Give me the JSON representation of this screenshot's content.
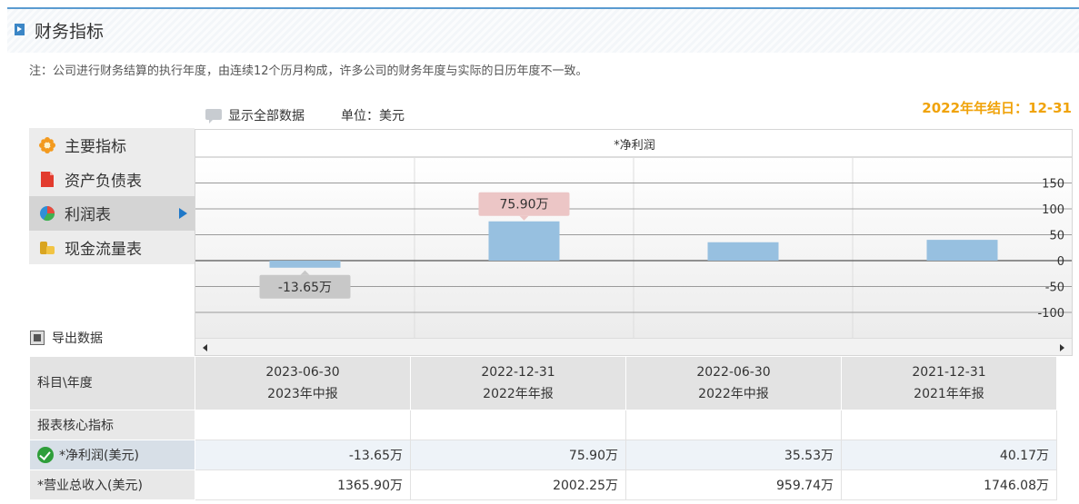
{
  "header": {
    "title": "财务指标"
  },
  "note": "注：公司进行财务结算的执行年度，由连续12个历月构成，许多公司的财务年度与实际的日历年度不一致。",
  "toolbar": {
    "show_all_label": "显示全部数据",
    "unit_label": "单位：美元",
    "year_end": "2022年年结日：12-31"
  },
  "menu": {
    "items": [
      {
        "label": "主要指标",
        "icon": "gear-flower-icon"
      },
      {
        "label": "资产负债表",
        "icon": "document-icon"
      },
      {
        "label": "利润表",
        "icon": "pie-chart-icon"
      },
      {
        "label": "现金流量表",
        "icon": "coins-icon"
      }
    ],
    "active_index": 2
  },
  "export_label": "导出数据",
  "chart_data": {
    "type": "bar",
    "title": "*净利润",
    "categories": [
      "2023-06-30",
      "2022-12-31",
      "2022-06-30",
      "2021-12-31"
    ],
    "values": [
      -13.65,
      75.9,
      35.53,
      40.17
    ],
    "data_labels": [
      "-13.65万",
      "75.90万",
      "",
      ""
    ],
    "yticks": [
      150,
      100,
      50,
      0,
      -50,
      -100
    ],
    "ylim": [
      -150,
      200
    ],
    "grid": true,
    "bar_color": "#97c0e0"
  },
  "table": {
    "corner": "科目\\年度",
    "columns": [
      {
        "date": "2023-06-30",
        "label": "2023年中报"
      },
      {
        "date": "2022-12-31",
        "label": "2022年年报"
      },
      {
        "date": "2022-06-30",
        "label": "2022年中报"
      },
      {
        "date": "2021-12-31",
        "label": "2021年年报"
      }
    ],
    "section": "报表核心指标",
    "rows": [
      {
        "label": "*净利润(美元)",
        "values": [
          "-13.65万",
          "75.90万",
          "35.53万",
          "40.17万"
        ]
      },
      {
        "label": "*营业总收入(美元)",
        "values": [
          "1365.90万",
          "2002.25万",
          "959.74万",
          "1746.08万"
        ]
      }
    ]
  }
}
